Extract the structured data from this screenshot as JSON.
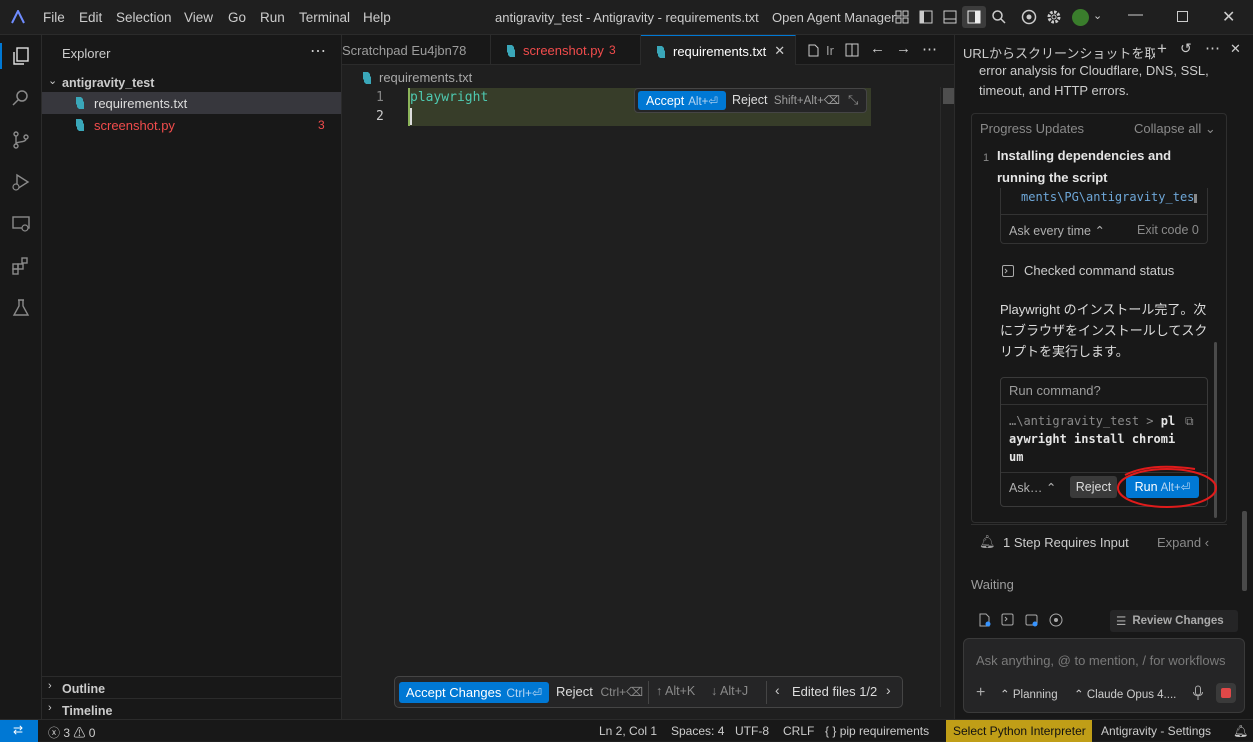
{
  "titlebar": {
    "menus": [
      "File",
      "Edit",
      "Selection",
      "View",
      "Go",
      "Run",
      "Terminal",
      "Help"
    ],
    "window_title": "antigravity_test - Antigravity - requirements.txt",
    "agent_manager": "Open Agent Manager"
  },
  "activity": [
    "explorer-icon",
    "search-icon",
    "source-control-icon",
    "run-debug-icon",
    "remote-explorer-icon",
    "extensions-icon",
    "testing-icon"
  ],
  "sidebar": {
    "title": "Explorer",
    "folder": "antigravity_test",
    "files": [
      {
        "name": "requirements.txt",
        "badge": ""
      },
      {
        "name": "screenshot.py",
        "badge": "3"
      }
    ],
    "outline": "Outline",
    "timeline": "Timeline"
  },
  "tabs": [
    {
      "label": "Scratchpad Eu4jbn78",
      "badge": ""
    },
    {
      "label": "screenshot.py",
      "badge": "3"
    },
    {
      "label": "requirements.txt",
      "badge": ""
    },
    {
      "label": "Ir",
      "badge": ""
    }
  ],
  "editor": {
    "breadcrumb": "requirements.txt",
    "lines": [
      {
        "num": "1",
        "text": "playwright"
      },
      {
        "num": "2",
        "text": ""
      }
    ],
    "inline_accept": "Accept",
    "inline_accept_key": "Alt+⏎",
    "inline_reject": "Reject",
    "inline_reject_key": "Shift+Alt+⌫",
    "bottom_accept": "Accept Changes",
    "bottom_accept_key": "Ctrl+⏎",
    "bottom_reject": "Reject",
    "bottom_reject_key": "Ctrl+⌫",
    "prev_key": "Alt+K",
    "next_key": "Alt+J",
    "edited_files": "Edited files 1/2"
  },
  "agent": {
    "title": "URLからスクリーンショットを取",
    "intro_text_1": "error analysis for Cloudflare, DNS, SSL,",
    "intro_text_2": "timeout, and HTTP errors.",
    "progress_label": "Progress Updates",
    "collapse_all": "Collapse all",
    "step_number": "1",
    "step_title_1": "Installing dependencies and",
    "step_title_2": "running the script",
    "terminal_path": "ments\\PG\\antigravity_tes",
    "ask_every_time": "Ask every time",
    "exit_code": "Exit code 0",
    "checked_status": "Checked command status",
    "message_1": "Playwright のインストール完了。次",
    "message_2": "にブラウザをインストールしてスク",
    "message_3": "リプトを実行します。",
    "run_command_label": "Run command?",
    "cmd_line_1_prefix": "…\\antigravity_test > ",
    "cmd_line_1": "pl",
    "cmd_line_2": "aywright install chromi",
    "cmd_line_3": "um",
    "ask_short": "Ask…",
    "reject": "Reject",
    "run": "Run",
    "run_key": "Alt+⏎",
    "requires_input": "1 Step Requires Input",
    "expand": "Expand",
    "waiting": "Waiting",
    "review_changes": "Review Changes",
    "input_placeholder": "Ask anything, @ to mention, / for workflows",
    "mode": "Planning",
    "model": "Claude Opus 4...."
  },
  "statusbar": {
    "errors": "3",
    "warnings": "0",
    "position": "Ln 2, Col 1",
    "spaces": "Spaces: 4",
    "encoding": "UTF-8",
    "eol": "CRLF",
    "language": "pip requirements",
    "interpreter": "Select Python Interpreter",
    "settings": "Antigravity - Settings"
  },
  "colors": {
    "accent": "#0078d4",
    "error": "#f14c4c",
    "warning_bg": "#c09e17",
    "annotation_red": "#e01b1b",
    "added_line_bg": "#373d29"
  }
}
